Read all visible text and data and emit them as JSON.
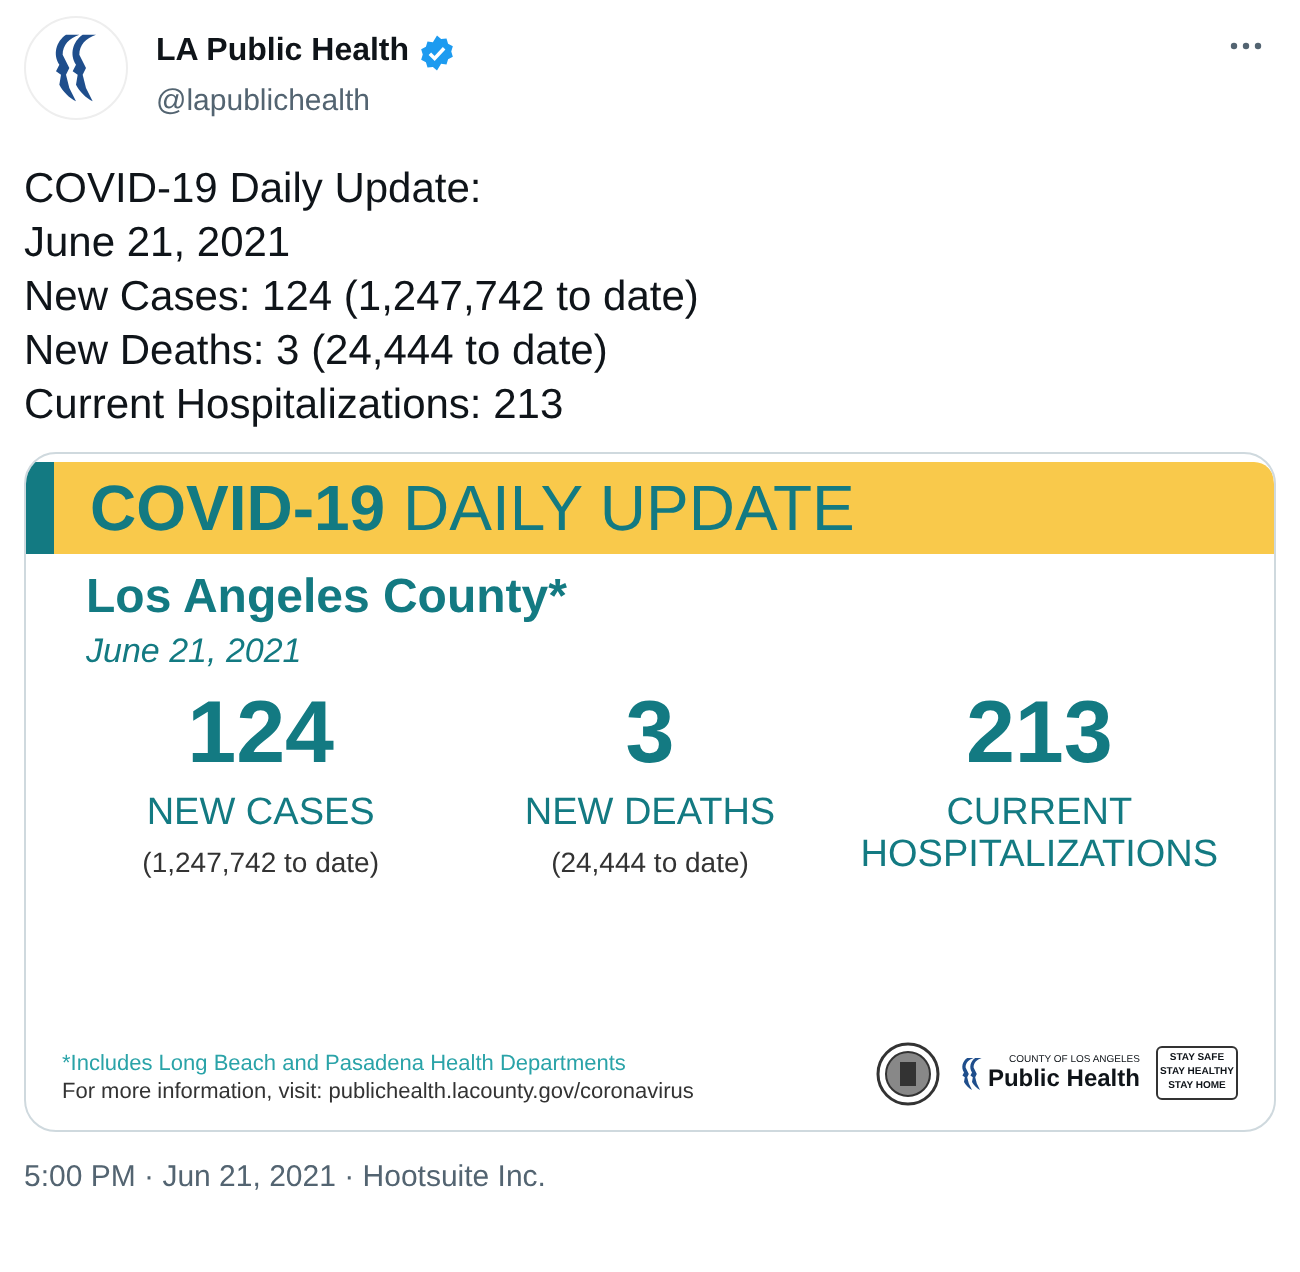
{
  "author": {
    "name": "LA Public Health",
    "verified": true,
    "handle": "@lapublichealth"
  },
  "tweet_lines": [
    "COVID-19 Daily Update:",
    "June 21, 2021",
    "New Cases: 124 (1,247,742 to date)",
    "New Deaths: 3 (24,444 to date)",
    "Current Hospitalizations: 213"
  ],
  "card": {
    "headline": "**COVID-19** DAILY UPDATE",
    "region": "Los Angeles County*",
    "date": "June 21, 2021",
    "stats": [
      {
        "value": "124",
        "label": "NEW CASES",
        "note": "(1,247,742 to date)"
      },
      {
        "value": "3",
        "label": "NEW DEATHS",
        "note": "(24,444 to date)"
      },
      {
        "value": "213",
        "label": "CURRENT HOSPITALIZATIONS"
      }
    ],
    "footnote": "*Includes Long Beach and Pasadena Health Departments",
    "more_info": "For more information, visit: publichealth.lacounty.gov/coronavirus",
    "logo_small": "COUNTY OF LOS ANGELES",
    "logo_name": "Public Health",
    "badge_lines": [
      "STAY SAFE",
      "STAY HEALTHY",
      "STAY HOME"
    ]
  },
  "meta": "5:00 PM · Jun 21, 2021 · Hootsuite Inc."
}
